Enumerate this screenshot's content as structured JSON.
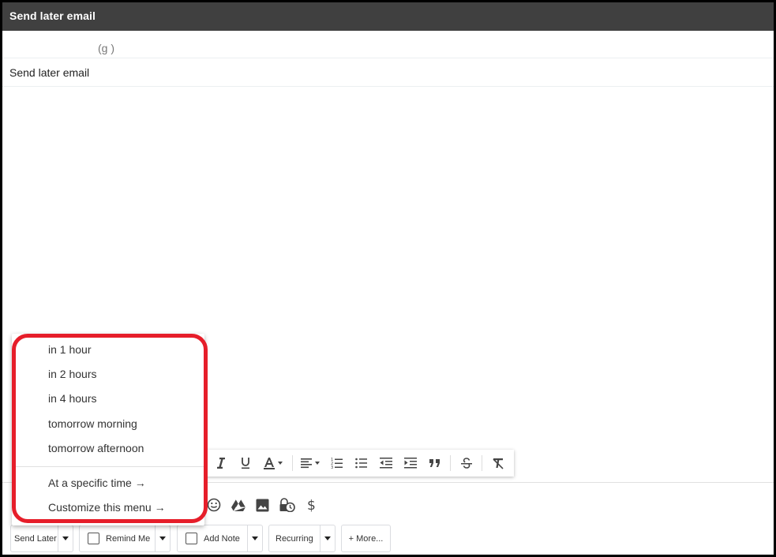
{
  "window": {
    "title": "Send later email"
  },
  "header_cut_text": "(g                 )",
  "subject": "Send later email",
  "send_later_menu": {
    "items": [
      "in 1 hour",
      "in 2 hours",
      "in 4 hours",
      "tomorrow morning",
      "tomorrow afternoon"
    ],
    "specific_time": "At a specific time →",
    "customize": "Customize this menu →"
  },
  "format_toolbar": {
    "icons": [
      "italic-icon",
      "underline-icon",
      "text-color-icon",
      "align-icon",
      "numbered-list-icon",
      "bulleted-list-icon",
      "indent-less-icon",
      "indent-more-icon",
      "quote-icon",
      "strikethrough-icon",
      "remove-formatting-icon"
    ]
  },
  "compose_icons": [
    "emoji-icon",
    "google-drive-icon",
    "insert-photo-icon",
    "confidential-mode-icon",
    "insert-money-icon"
  ],
  "buttons": {
    "send_later": "Send Later",
    "remind_me": "Remind Me",
    "add_note": "Add Note",
    "recurring": "Recurring",
    "more": "+ More..."
  },
  "colors": {
    "titlebar": "#404040",
    "highlight": "#e61e2a"
  }
}
